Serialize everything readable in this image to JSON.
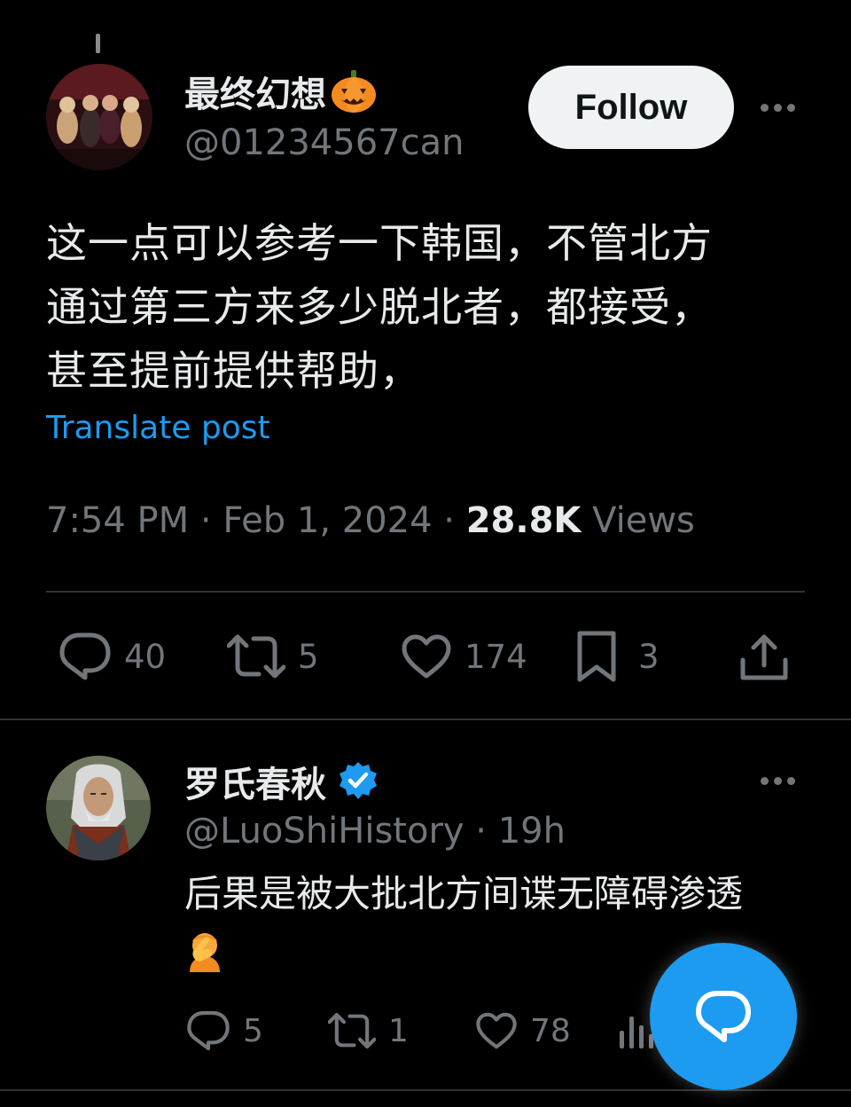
{
  "main_post": {
    "display_name": "最终幻想",
    "name_emoji": "pumpkin-emoji",
    "handle": "@01234567can",
    "follow_label": "Follow",
    "text_lines": [
      "这一点可以参考一下韩国，不管北方",
      "通过第三方来多少脱北者，都接受，",
      "甚至提前提供帮助，"
    ],
    "translate_label": "Translate post",
    "time": "7:54 PM",
    "separator": "·",
    "date": "Feb 1, 2024",
    "views_count": "28.8K",
    "views_label": "Views",
    "replies": "40",
    "reposts": "5",
    "likes": "174",
    "bookmarks": "3"
  },
  "reply_post": {
    "display_name": "罗氏春秋",
    "verified": true,
    "handle": "@LuoShiHistory",
    "separator": "·",
    "time_ago": "19h",
    "text": "后果是被大批北方间谍无障碍渗透",
    "emoji": "facepalm-emoji",
    "replies": "5",
    "reposts": "1",
    "likes": "78"
  },
  "colors": {
    "background": "#000000",
    "text_primary": "#e7e9ea",
    "text_secondary": "#71767b",
    "accent": "#1d9bf0",
    "divider": "#2f3336",
    "follow_bg": "#eff3f4"
  }
}
